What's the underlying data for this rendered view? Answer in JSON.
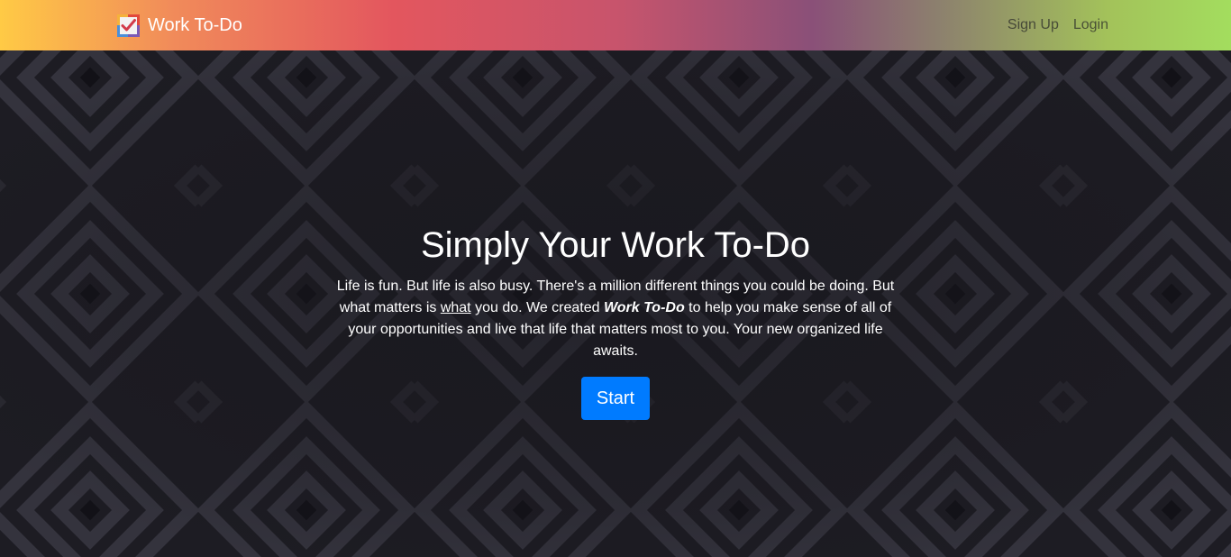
{
  "navbar": {
    "brand": "Work To-Do",
    "logo_icon": "checklist-logo-icon",
    "links": [
      "Sign Up",
      "Login"
    ]
  },
  "hero": {
    "title": "Simply Your Work To-Do",
    "text_part1": "Life is fun. But life is also busy. There's a million different things you could be doing. But what matters is ",
    "emphasis_word": "what",
    "text_part2": " you do. We created ",
    "app_name": "Work To-Do",
    "text_part3": " to help you make sense of all of your opportunities and live that life that matters most to you. Your new organized life awaits.",
    "button_label": "Start"
  },
  "colors": {
    "accent": "#007bff",
    "hero_background": "#1e1d24",
    "navbar_gradient": [
      "#ffca45",
      "#e3565e",
      "#8a5078",
      "#a3dd5e"
    ]
  }
}
